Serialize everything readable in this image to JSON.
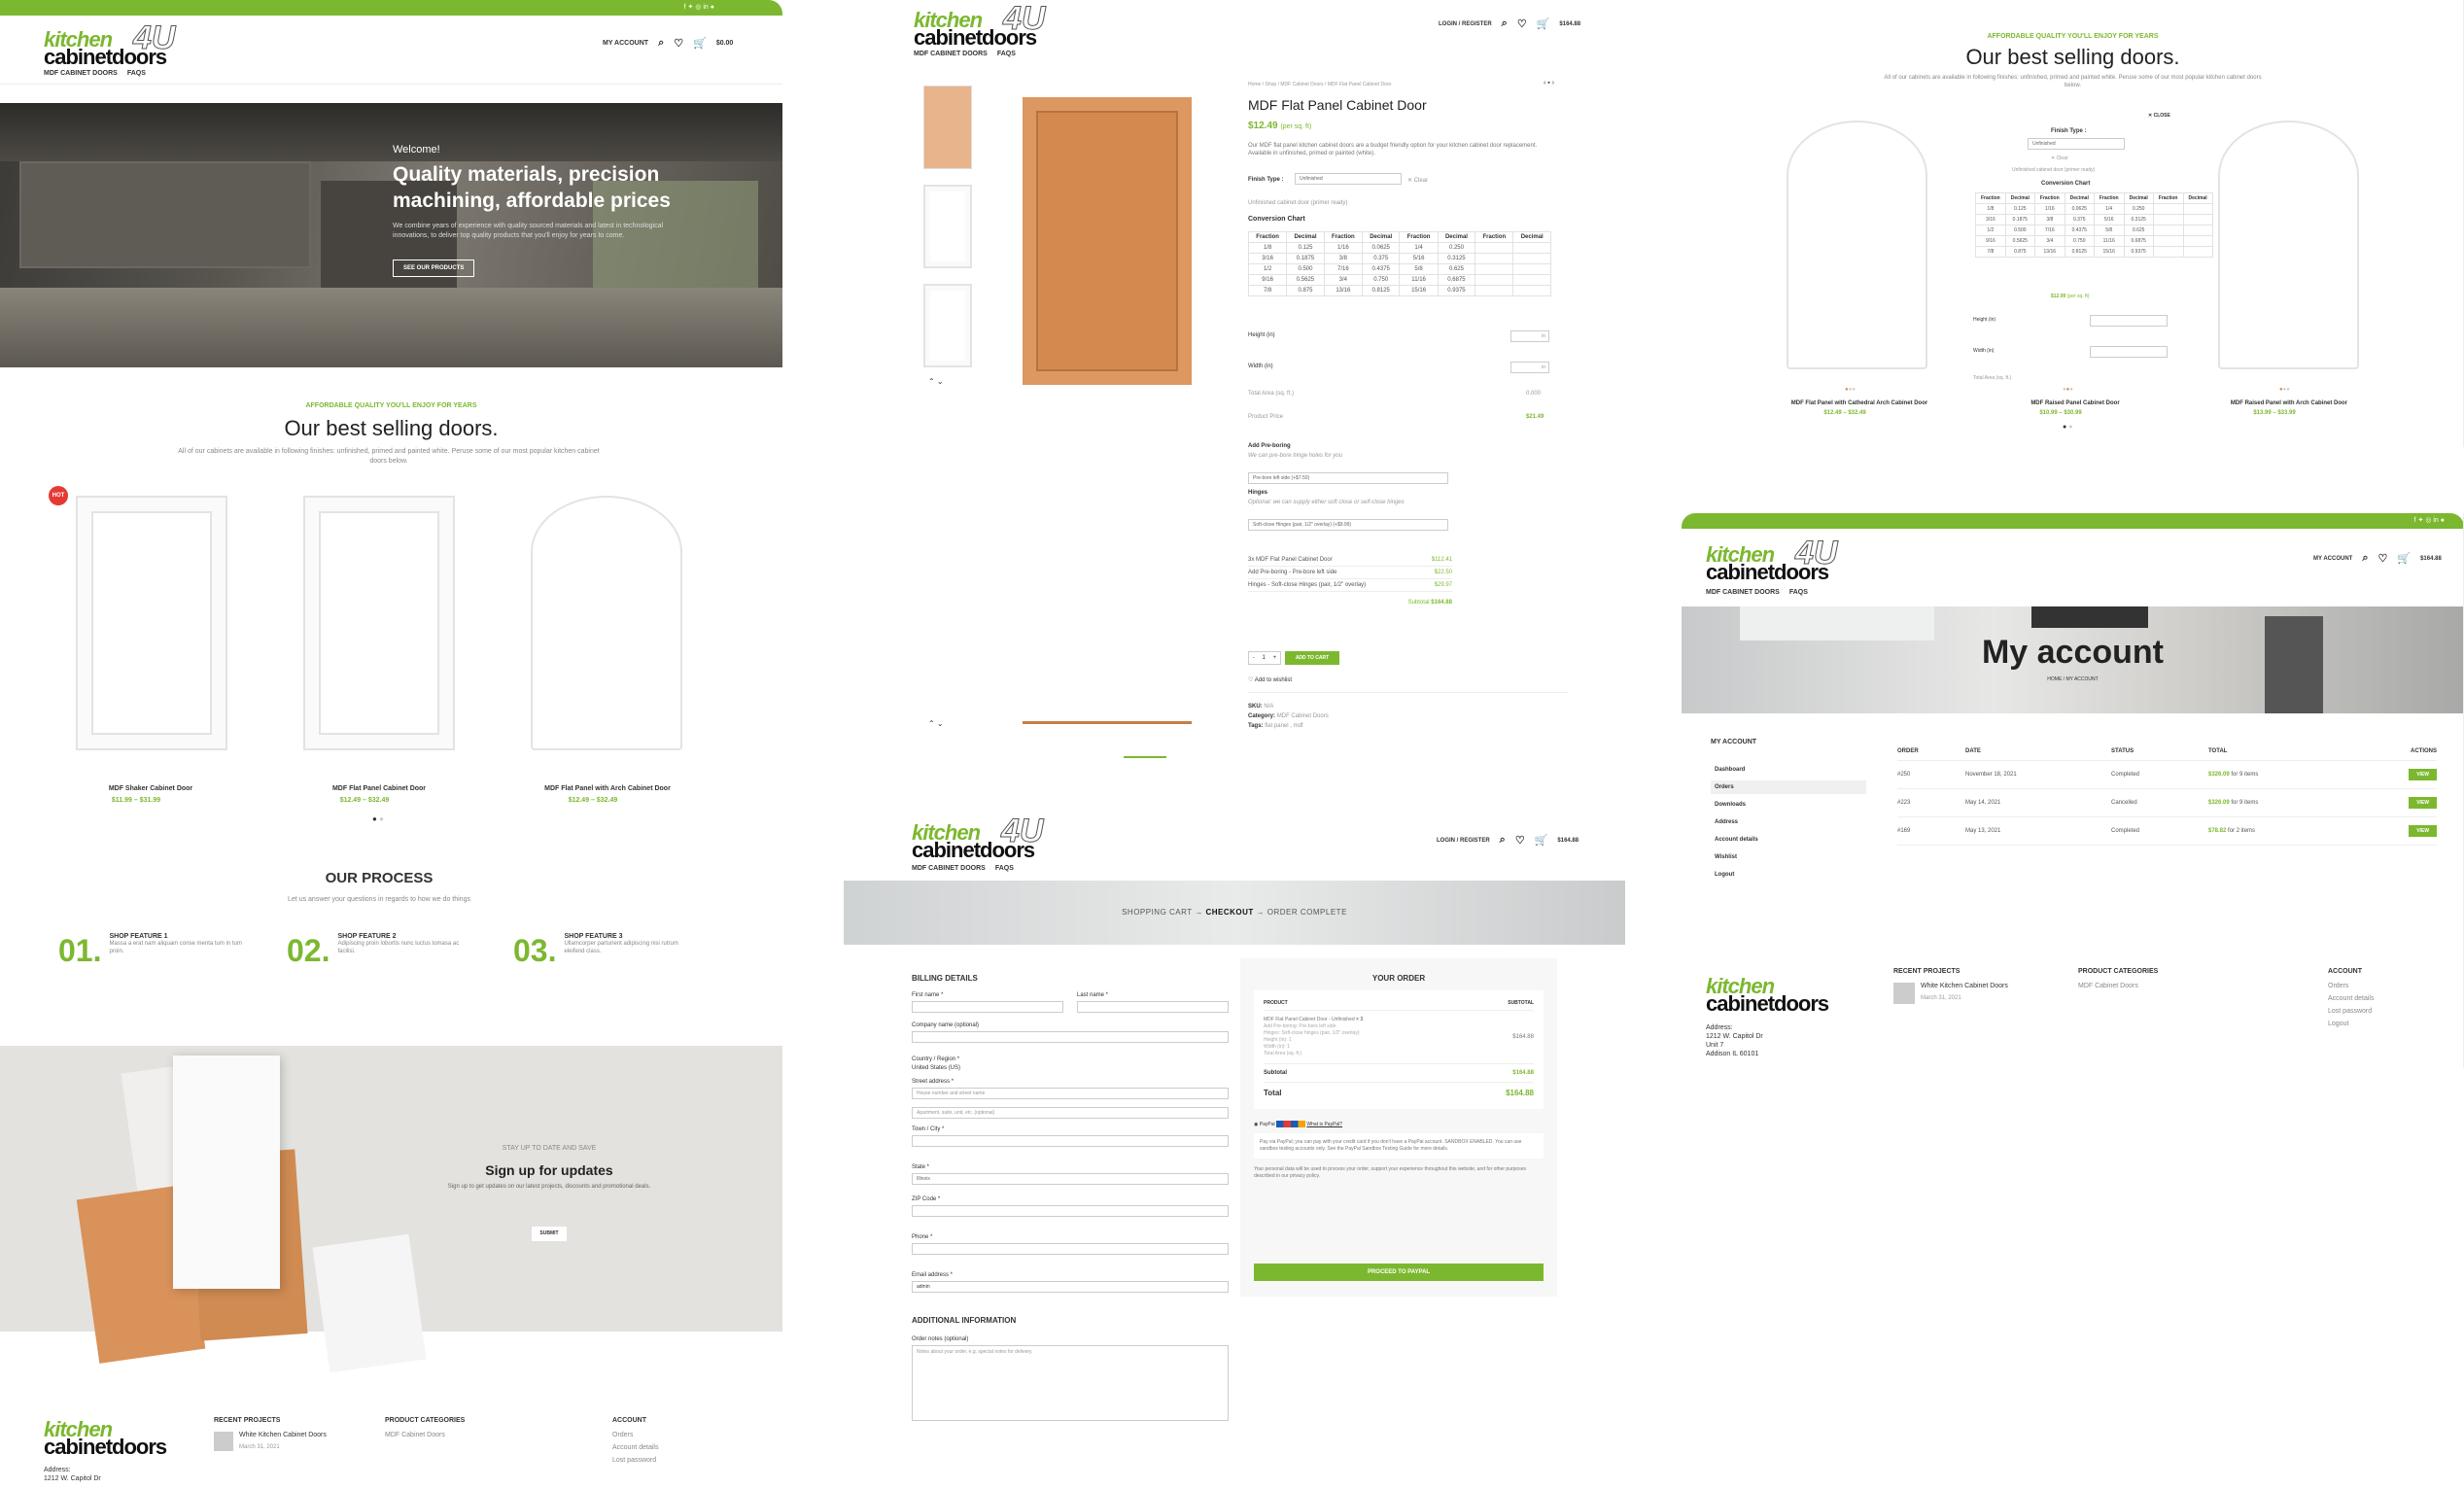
{
  "brand": {
    "logo_kitchen": "kitchen",
    "logo_cabinet": "cabinetdoors",
    "logo_4u": "4U",
    "accent": "#7cb82f"
  },
  "nav": {
    "mdf": "MDF CABINET DOORS",
    "faqs": "FAQS",
    "my_account": "MY ACCOUNT",
    "login": "LOGIN / REGISTER",
    "cart_total": "$0.00",
    "cart_total_2": "$164.88",
    "cart_count": "0",
    "cart_count_2": "3"
  },
  "home": {
    "hero_welcome": "Welcome!",
    "hero_title": "Quality materials, precision machining, affordable prices",
    "hero_text": "We combine years of experience with quality sourced materials and latest in technological innovations, to deliver top quality products that you'll enjoy for years to come.",
    "hero_button": "SEE OUR PRODUCTS",
    "kicker": "AFFORDABLE QUALITY YOU'LL ENJOY FOR YEARS",
    "best_title": "Our best selling doors.",
    "best_text": "All of our cabinets are available in following finishes: unfinished, primed and painted white. Peruse some of our most popular kitchen cabinet doors below.",
    "hot_badge": "HOT",
    "products": [
      {
        "name": "MDF Shaker Cabinet Door",
        "price": "$11.99 – $31.99",
        "unit": "(per sq. ft)"
      },
      {
        "name": "MDF Flat Panel Cabinet Door",
        "price": "$12.49 – $32.49",
        "unit": "(per sq. ft)"
      },
      {
        "name": "MDF Flat Panel with Arch Cabinet Door",
        "price": "$12.49 – $32.49",
        "unit": "(per sq. ft)"
      }
    ],
    "process_title": "OUR PROCESS",
    "process_sub": "Let us answer your questions in regards to how we do things",
    "features": [
      {
        "num": "01.",
        "title": "SHOP FEATURE 1",
        "text": "Massa a erat nam aliquam conse menta tum in tum proin."
      },
      {
        "num": "02.",
        "title": "SHOP FEATURE 2",
        "text": "Adipiscing proin lobortis nunc luctus tomasa ac facilisi."
      },
      {
        "num": "03.",
        "title": "SHOP FEATURE 3",
        "text": "Ullamcorper parturient adipiscing nisi rutrum eleifend class."
      }
    ],
    "signup_kicker": "STAY UP TO DATE AND SAVE",
    "signup_title": "Sign up for updates",
    "signup_text": "Sign up to get updates on our latest projects, discounts and promotional deals.",
    "signup_button": "SUBMIT"
  },
  "footer": {
    "recent": "RECENT PROJECTS",
    "project": "White Kitchen Cabinet Doors",
    "project_date": "March 31, 2021",
    "cats": "PRODUCT CATEGORIES",
    "cat1": "MDF Cabinet Doors",
    "account": "ACCOUNT",
    "a1": "Orders",
    "a2": "Account details",
    "a3": "Lost password",
    "a4": "Logout",
    "address_label": "Address:",
    "addr1": "1212 W. Capitol Dr",
    "addr2": "Unit 7",
    "addr3": "Addison IL 60101"
  },
  "product": {
    "breadcrumb": "Home / Shop / MDF Cabinet Doors / MDF Flat Panel Cabinet Door",
    "title": "MDF Flat Panel Cabinet Door",
    "price": "$12.49",
    "price_unit": "(per sq. ft)",
    "desc": "Our MDF flat panel kitchen cabinet doors are a budget friendly option for your kitchen cabinet door replacement. Available in unfinished, primed or painted (white).",
    "finish_label": "Finish Type :",
    "finish_value": "Unfinished",
    "clear": "✕ Clear",
    "finish_note": "Unfinished cabinet door (primer ready)",
    "chart_title": "Conversion Chart",
    "chart_headers": [
      "Fraction",
      "Decimal",
      "Fraction",
      "Decimal",
      "Fraction",
      "Decimal",
      "Fraction",
      "Decimal"
    ],
    "chart_rows": [
      [
        "1/8",
        "0.125",
        "1/16",
        "0.0625",
        "1/4",
        "0.250"
      ],
      [
        "3/16",
        "0.1875",
        "3/8",
        "0.375",
        "5/16",
        "0.3125"
      ],
      [
        "1/2",
        "0.500",
        "7/16",
        "0.4375",
        "5/8",
        "0.625"
      ],
      [
        "9/16",
        "0.5625",
        "3/4",
        "0.750",
        "11/16",
        "0.6875"
      ],
      [
        "7/8",
        "0.875",
        "13/16",
        "0.8125",
        "15/16",
        "0.9375"
      ]
    ],
    "height_label": "Height (in)",
    "width_label": "Width (in)",
    "in": "in",
    "area_label": "Total Area (sq. ft.)",
    "area_value": "0.000",
    "pp_label": "Product Price",
    "pp_value": "$21.49",
    "boring_title": "Add Pre-boring",
    "boring_note": "We can pre-bore hinge holes for you",
    "boring_value": "Pre-bore left side (+$7.50)",
    "hinges_title": "Hinges",
    "hinges_note": "Optional: we can supply either soft close or self-close hinges",
    "hinges_value": "Soft-close Hinges (pair, 1/2\" overlay) (+$9.99)",
    "sum1": "3x MDF Flat Panel Cabinet Door",
    "sum1v": "$112.41",
    "sum2": "Add Pre-boring - Pre-bore left side",
    "sum2v": "$22.50",
    "sum3": "Hinges - Soft-close Hinges (pair, 1/2\" overlay)",
    "sum3v": "$29.97",
    "subtotal_label": "Subtotal",
    "subtotal": "$164.88",
    "qty": "1",
    "add_to_cart": "ADD TO CART",
    "wishlist": "Add to wishlist",
    "sku": "SKU:",
    "sku_v": "N/A",
    "cat": "Category:",
    "cat_v": "MDF Cabinet Doors",
    "tags": "Tags:",
    "tags_v": "flat panel , mdf"
  },
  "quick": {
    "kicker": "AFFORDABLE QUALITY YOU'LL ENJOY FOR YEARS",
    "title": "Our best selling doors.",
    "text": "All of our cabinets are available in following finishes: unfinished, primed and painted white. Peruse some of our most popular kitchen cabinet doors below.",
    "close": "✕ CLOSE",
    "finish_label": "Finish Type :",
    "finish_value": "Unfinished",
    "clear": "✕ Clear",
    "note": "Unfinished cabinet door (primer ready)",
    "chart_title": "Conversion Chart",
    "price": "$12.99",
    "price_unit": "(per sq. ft)",
    "height": "Height (in)",
    "width": "Width (in)",
    "area": "Total Area (sq. ft.)",
    "products": [
      {
        "name": "MDF Flat Panel with Cathedral Arch Cabinet Door",
        "price": "$12.49 – $32.49",
        "unit": "(per sq. ft)"
      },
      {
        "name": "MDF Raised Panel Cabinet Door",
        "price": "$10.99 – $30.99",
        "unit": "(per sq. ft)"
      },
      {
        "name": "MDF Raised Panel with Arch Cabinet Door",
        "price": "$13.99 – $33.99",
        "unit": "(per sq. ft)"
      }
    ]
  },
  "checkout": {
    "steps": [
      "SHOPPING CART",
      "CHECKOUT",
      "ORDER COMPLETE"
    ],
    "billing": "BILLING DETAILS",
    "first": "First name *",
    "last": "Last name *",
    "company": "Company name (optional)",
    "country": "Country / Region *",
    "country_v": "United States (US)",
    "street": "Street address *",
    "street_ph": "House number and street name",
    "apt_ph": "Apartment, suite, unit, etc. (optional)",
    "town": "Town / City *",
    "state": "State *",
    "state_v": "Illinois",
    "zip": "ZIP Code *",
    "phone": "Phone *",
    "email": "Email address *",
    "email_v": "admin",
    "additional": "ADDITIONAL INFORMATION",
    "notes": "Order notes (optional)",
    "notes_ph": "Notes about your order, e.g. special notes for delivery.",
    "your_order": "YOUR ORDER",
    "product_h": "PRODUCT",
    "subtotal_h": "SUBTOTAL",
    "item": "MDF Flat Panel Cabinet Door - Unfinished",
    "item_qty": "× 3",
    "item_price": "$164.88",
    "item_meta": [
      "Add Pre-boring: Pre-bore left side",
      "Hinges: Soft-close hinges (pair, 1/2\" overlay)",
      "Height (in): 1",
      "Width (in): 1",
      "Total Area (sq. ft.)"
    ],
    "subtotal": "Subtotal",
    "subtotal_v": "$164.88",
    "total": "Total",
    "total_v": "$164.88",
    "paypal": "PayPal",
    "what_paypal": "What is PayPal?",
    "paypal_text": "Pay via PayPal; you can pay with your credit card if you don't have a PayPal account. SANDBOX ENABLED. You can use sandbox testing accounts only. See the PayPal Sandbox Testing Guide for more details.",
    "privacy": "Your personal data will be used to process your order, support your experience throughout this website, and for other purposes described in our privacy policy.",
    "proceed": "PROCEED TO PAYPAL"
  },
  "account": {
    "title": "My account",
    "crumb": "HOME / MY ACCOUNT",
    "side_title": "MY ACCOUNT",
    "menu": [
      "Dashboard",
      "Orders",
      "Downloads",
      "Address",
      "Account details",
      "Wishlist",
      "Logout"
    ],
    "headers": [
      "ORDER",
      "DATE",
      "STATUS",
      "TOTAL",
      "ACTIONS"
    ],
    "orders": [
      {
        "id": "#250",
        "date": "November 18, 2021",
        "status": "Completed",
        "total": "$326.09",
        "items": "for 9 items"
      },
      {
        "id": "#223",
        "date": "May 14, 2021",
        "status": "Cancelled",
        "total": "$326.09",
        "items": "for 9 items"
      },
      {
        "id": "#169",
        "date": "May 13, 2021",
        "status": "Completed",
        "total": "$78.82",
        "items": "for 2 items"
      }
    ],
    "view": "VIEW"
  }
}
